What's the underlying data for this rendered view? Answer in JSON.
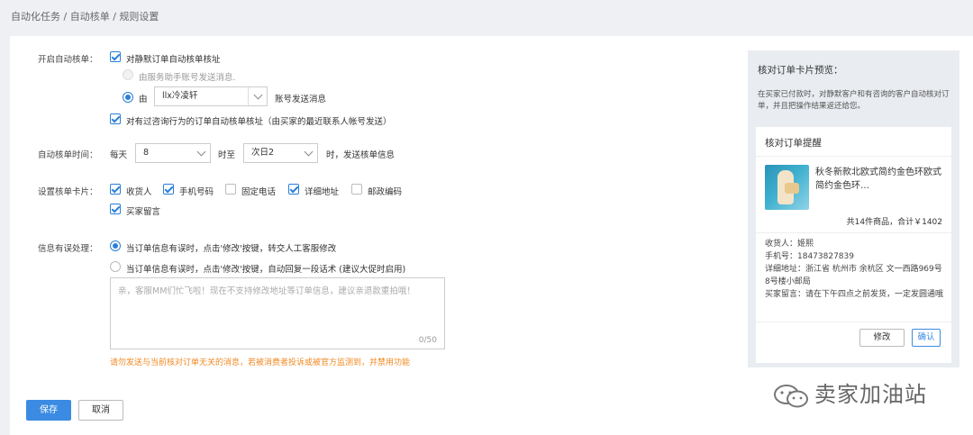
{
  "breadcrumb": "自动化任务 / 自动核单 / 规则设置",
  "auto_check": {
    "label": "开启自动核单：",
    "enable_label": "对静默订单自动核单核址",
    "enable_checked": true,
    "option_service": "由服务助手账号发送消息.",
    "option_by": "由",
    "account_value": "llx冷凌轩",
    "account_suffix": "账号发送消息",
    "inquiry_label": "对有过咨询行为的订单自动核单核址（由买家的最近联系人帐号发送）",
    "inquiry_checked": true
  },
  "time": {
    "label": "自动核单时间：",
    "every_day": "每天",
    "start_value": "8",
    "to": "时至",
    "end_value": "次日2",
    "suffix": "时，发送核单信息"
  },
  "fields": {
    "label": "设置核单卡片：",
    "items": [
      {
        "label": "收货人",
        "checked": true
      },
      {
        "label": "手机号码",
        "checked": true
      },
      {
        "label": "固定电话",
        "checked": false
      },
      {
        "label": "详细地址",
        "checked": true
      },
      {
        "label": "邮政编码",
        "checked": false
      },
      {
        "label": "买家留言",
        "checked": true
      }
    ]
  },
  "error": {
    "label": "信息有误处理：",
    "option1": "当订单信息有误时，点击'修改'按键，转交人工客服修改",
    "option2": "当订单信息有误时，点击'修改'按键，自动回复一段话术 (建议大促时启用)",
    "placeholder": "亲，客服MM们忙飞啦！现在不支持修改地址等订单信息，建议亲退款重拍哦！",
    "count": "0/50",
    "warning": "请勿发送与当前核对订单无关的消息，若被消费者投诉或被官方监测到，并禁用功能"
  },
  "actions": {
    "save": "保存",
    "cancel": "取消"
  },
  "preview": {
    "title": "核对订单卡片预览：",
    "desc": "在买家已付款时，对静默客户和有咨询的客户自动核对订单，并且把操作结果返还给您。",
    "card_title": "核对订单提醒",
    "product_name": "秋冬新款北欧式简约金色环欧式简约金色环…",
    "total": "共14件商品，合计￥1402",
    "receiver": "收货人：姬熙",
    "phone": "手机号：18473827839",
    "address": "详细地址：浙江省 杭州市 余杭区 文一西路969号 8号楼小邮局",
    "message": "买家留言：请在下午四点之前发货，一定发圆通哦",
    "edit": "修改",
    "confirm": "确认"
  },
  "watermark": "卖家加油站",
  "colors": {
    "accent": "#3b8be2",
    "warning": "#f08a24",
    "background": "#eef0f4"
  }
}
